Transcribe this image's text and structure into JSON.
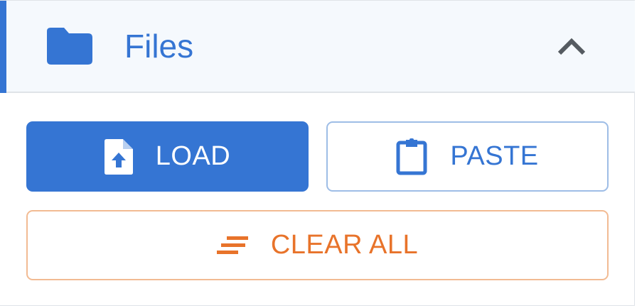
{
  "header": {
    "title": "Files",
    "icon": "folder-icon",
    "toggle_icon": "chevron-up-icon"
  },
  "actions": {
    "load_label": "LOAD",
    "load_icon": "file-upload-icon",
    "paste_label": "PASTE",
    "paste_icon": "clipboard-icon",
    "clear_label": "CLEAR ALL",
    "clear_icon": "clear-lines-icon"
  },
  "colors": {
    "accent": "#3575d3",
    "warning": "#e8732a",
    "header_bg": "#f5f9fd"
  }
}
